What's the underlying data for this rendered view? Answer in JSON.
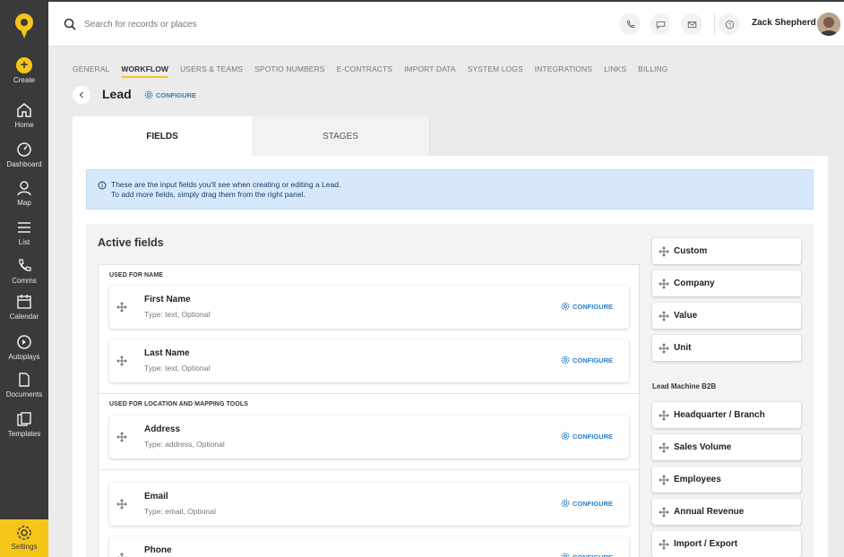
{
  "sidebar": {
    "create_label": "Create",
    "items": [
      {
        "label": "Home",
        "icon": "home-icon"
      },
      {
        "label": "Dashboard",
        "icon": "dashboard-icon"
      },
      {
        "label": "Map",
        "icon": "map-pin-icon"
      },
      {
        "label": "List",
        "icon": "list-icon"
      },
      {
        "label": "Comms",
        "icon": "phone-icon"
      },
      {
        "label": "Calendar",
        "icon": "calendar-icon"
      },
      {
        "label": "Autoplays",
        "icon": "autoplay-icon"
      },
      {
        "label": "Documents",
        "icon": "document-icon"
      },
      {
        "label": "Templates",
        "icon": "templates-icon"
      }
    ],
    "settings_label": "Settings"
  },
  "topbar": {
    "search_placeholder": "Search for records or places",
    "user_name": "Zack Shepherd"
  },
  "settings_tabs": [
    "GENERAL",
    "WORKFLOW",
    "USERS & TEAMS",
    "SPOTIO NUMBERS",
    "E-CONTRACTS",
    "IMPORT DATA",
    "SYSTEM LOGS",
    "INTEGRATIONS",
    "LINKS",
    "BILLING"
  ],
  "page": {
    "title": "Lead",
    "configure_label": "CONFIGURE"
  },
  "field_tabs": {
    "fields": "FIELDS",
    "stages": "STAGES"
  },
  "info": {
    "line1": "These are the input fields you'll see when creating or editing a Lead.",
    "line2": "To add more fields, simply drag them from the right panel."
  },
  "active_fields": {
    "title": "Active fields",
    "groups": [
      {
        "title": "USED FOR NAME",
        "fields": [
          {
            "name": "First Name",
            "type": "Type: text, Optional"
          },
          {
            "name": "Last Name",
            "type": "Type: text, Optional"
          }
        ]
      },
      {
        "title": "USED FOR LOCATION AND MAPPING TOOLS",
        "fields": [
          {
            "name": "Address",
            "type": "Type: address, Optional"
          }
        ]
      },
      {
        "title": "",
        "fields": [
          {
            "name": "Email",
            "type": "Type: email, Optional"
          },
          {
            "name": "Phone",
            "type": ""
          }
        ]
      }
    ],
    "configure_label": "CONFIGURE"
  },
  "right_panel": {
    "custom_items": [
      "Custom",
      "Company",
      "Value",
      "Unit"
    ],
    "section_title": "Lead Machine B2B",
    "b2b_items": [
      "Headquarter / Branch",
      "Sales Volume",
      "Employees",
      "Annual Revenue",
      "Import / Export"
    ]
  },
  "colors": {
    "accent": "#f5c518",
    "link": "#2a7ec5",
    "sidebar": "#3a3a3a"
  }
}
